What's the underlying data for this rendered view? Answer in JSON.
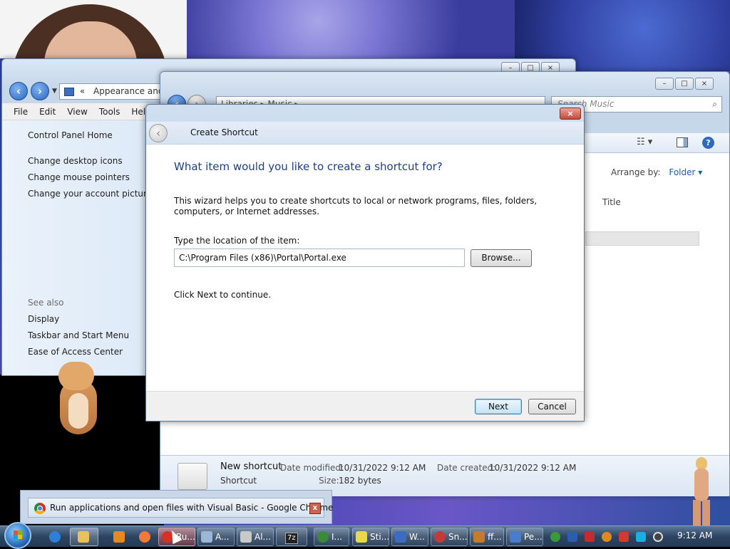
{
  "control_panel": {
    "breadcrumb_chevron": "«",
    "address": "Appearance and Pe",
    "menu": [
      "File",
      "Edit",
      "View",
      "Tools",
      "Help"
    ],
    "tasks": [
      "Control Panel Home",
      "Change desktop icons",
      "Change mouse pointers",
      "Change your account picture"
    ],
    "see_also_heading": "See also",
    "see_also": [
      "Display",
      "Taskbar and Start Menu",
      "Ease of Access Center"
    ],
    "caption_buttons": [
      "–",
      "□",
      "×"
    ]
  },
  "music_window": {
    "address": "Libraries ▸ Music ▸",
    "search_placeholder": "Search Music",
    "arrange_label": "Arrange by:",
    "arrange_value": "Folder",
    "column_title": "Title",
    "caption_buttons": [
      "–",
      "□",
      "×"
    ],
    "details": {
      "name": "New shortcut",
      "type": "Shortcut",
      "modified_label": "Date modified:",
      "modified_value": "10/31/2022 9:12 AM",
      "created_label": "Date created:",
      "created_value": "10/31/2022 9:12 AM",
      "size_label": "Size:",
      "size_value": "182 bytes"
    }
  },
  "dialog": {
    "title": "Create Shortcut",
    "close_symbol": "×",
    "heading": "What item would you like to create a shortcut for?",
    "description": "This wizard helps you to create shortcuts to local or network programs, files, folders, computers, or Internet addresses.",
    "location_label": "Type the location of the item:",
    "location_value": "C:\\Program Files (x86)\\Portal\\Portal.exe",
    "browse_label": "Browse...",
    "continue_text": "Click Next to continue.",
    "next_label": "Next",
    "cancel_label": "Cancel"
  },
  "tooltip": {
    "text": "Run applications and open files with Visual Basic - Google Chrome",
    "close_symbol": "x"
  },
  "taskbar": {
    "items": [
      {
        "label": "Ru...",
        "icon": "chrome-icon",
        "color": "#d93025"
      },
      {
        "label": "A...",
        "icon": "window-icon",
        "color": "#9ab7d6"
      },
      {
        "label": "Al...",
        "icon": "folder-icon",
        "color": "#c9c9c9"
      },
      {
        "label": "7z",
        "icon": "7zip-icon",
        "color": "#222222"
      },
      {
        "label": "I...",
        "icon": "network-icon",
        "color": "#3a8a3a"
      },
      {
        "label": "Sti...",
        "icon": "notes-icon",
        "color": "#e8d84a"
      },
      {
        "label": "W...",
        "icon": "vb-icon",
        "color": "#3b6bc2"
      },
      {
        "label": "Sn...",
        "icon": "snipping-icon",
        "color": "#c23b3b"
      },
      {
        "label": "ff...",
        "icon": "media-icon",
        "color": "#c67a2c"
      },
      {
        "label": "Pe...",
        "icon": "control-panel-icon",
        "color": "#4a7cc9"
      }
    ],
    "clock": "9:12 AM"
  },
  "colors": {
    "accent_heading": "#1c3f8a",
    "link": "#1a5fb4",
    "taskbar": "#2d4461"
  }
}
